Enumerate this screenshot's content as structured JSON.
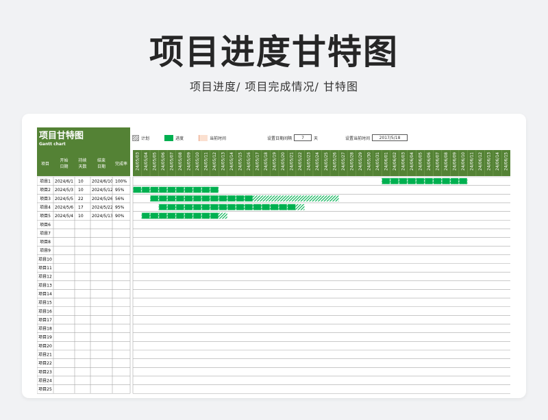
{
  "page": {
    "title": "项目进度甘特图",
    "subtitle": "项目进度/  项目完成情况/  甘特图"
  },
  "sheet": {
    "title": "项目甘特图",
    "subtitle": "Gantt chart",
    "legend": {
      "plan": "计划",
      "progress": "进度",
      "today": "当前时间"
    },
    "controls": {
      "interval_label": "设置日期间隔",
      "interval_value": "7",
      "interval_unit": "天",
      "current_label": "设置当前时间",
      "current_value": "2017/5/18"
    },
    "headers": [
      "项目",
      "开始日期",
      "持续天数",
      "结束日期",
      "完成率"
    ],
    "colors": {
      "header": "#548235",
      "plan": "#00b050",
      "progress": "#00b050",
      "grid": "#a6a6a6"
    },
    "dates": [
      "24/05/03",
      "24/05/04",
      "24/05/05",
      "24/05/06",
      "24/05/07",
      "24/05/08",
      "24/05/09",
      "24/05/10",
      "24/05/11",
      "24/05/12",
      "24/05/13",
      "24/05/14",
      "24/05/15",
      "24/05/16",
      "24/05/17",
      "24/05/18",
      "24/05/19",
      "24/05/20",
      "24/05/21",
      "24/05/22",
      "24/05/23",
      "24/05/24",
      "24/05/25",
      "24/05/26",
      "24/05/27",
      "24/05/28",
      "24/05/29",
      "24/05/30",
      "24/05/31",
      "24/06/01",
      "24/06/02",
      "24/06/03",
      "24/06/04",
      "24/06/05",
      "24/06/06",
      "24/06/07",
      "24/06/08",
      "24/06/09",
      "24/06/10",
      "24/06/11",
      "24/06/12",
      "24/06/13",
      "24/06/14",
      "24/06/15"
    ],
    "rows": [
      {
        "name": "项目1",
        "start": "2024/6/1",
        "days": "10",
        "end": "2024/6/10",
        "rate": "100%",
        "s": 29,
        "d": 10,
        "p": 1.0
      },
      {
        "name": "项目2",
        "start": "2024/5/3",
        "days": "10",
        "end": "2024/5/12",
        "rate": "95%",
        "s": 0,
        "d": 10,
        "p": 0.95
      },
      {
        "name": "项目3",
        "start": "2024/5/5",
        "days": "22",
        "end": "2024/5/26",
        "rate": "56%",
        "s": 2,
        "d": 22,
        "p": 0.56
      },
      {
        "name": "项目4",
        "start": "2024/5/6",
        "days": "17",
        "end": "2024/5/22",
        "rate": "95%",
        "s": 3,
        "d": 17,
        "p": 0.95
      },
      {
        "name": "项目5",
        "start": "2024/5/4",
        "days": "10",
        "end": "2024/5/13",
        "rate": "90%",
        "s": 1,
        "d": 10,
        "p": 0.9
      },
      {
        "name": "项目6",
        "start": "",
        "days": "",
        "end": "",
        "rate": ""
      },
      {
        "name": "项目7",
        "start": "",
        "days": "",
        "end": "",
        "rate": ""
      },
      {
        "name": "项目8",
        "start": "",
        "days": "",
        "end": "",
        "rate": ""
      },
      {
        "name": "项目9",
        "start": "",
        "days": "",
        "end": "",
        "rate": ""
      },
      {
        "name": "项目10",
        "start": "",
        "days": "",
        "end": "",
        "rate": ""
      },
      {
        "name": "项目11",
        "start": "",
        "days": "",
        "end": "",
        "rate": ""
      },
      {
        "name": "项目12",
        "start": "",
        "days": "",
        "end": "",
        "rate": ""
      },
      {
        "name": "项目13",
        "start": "",
        "days": "",
        "end": "",
        "rate": ""
      },
      {
        "name": "项目14",
        "start": "",
        "days": "",
        "end": "",
        "rate": ""
      },
      {
        "name": "项目15",
        "start": "",
        "days": "",
        "end": "",
        "rate": ""
      },
      {
        "name": "项目16",
        "start": "",
        "days": "",
        "end": "",
        "rate": ""
      },
      {
        "name": "项目17",
        "start": "",
        "days": "",
        "end": "",
        "rate": ""
      },
      {
        "name": "项目18",
        "start": "",
        "days": "",
        "end": "",
        "rate": ""
      },
      {
        "name": "项目19",
        "start": "",
        "days": "",
        "end": "",
        "rate": ""
      },
      {
        "name": "项目20",
        "start": "",
        "days": "",
        "end": "",
        "rate": ""
      },
      {
        "name": "项目21",
        "start": "",
        "days": "",
        "end": "",
        "rate": ""
      },
      {
        "name": "项目22",
        "start": "",
        "days": "",
        "end": "",
        "rate": ""
      },
      {
        "name": "项目23",
        "start": "",
        "days": "",
        "end": "",
        "rate": ""
      },
      {
        "name": "项目24",
        "start": "",
        "days": "",
        "end": "",
        "rate": ""
      },
      {
        "name": "项目25",
        "start": "",
        "days": "",
        "end": "",
        "rate": ""
      }
    ]
  }
}
